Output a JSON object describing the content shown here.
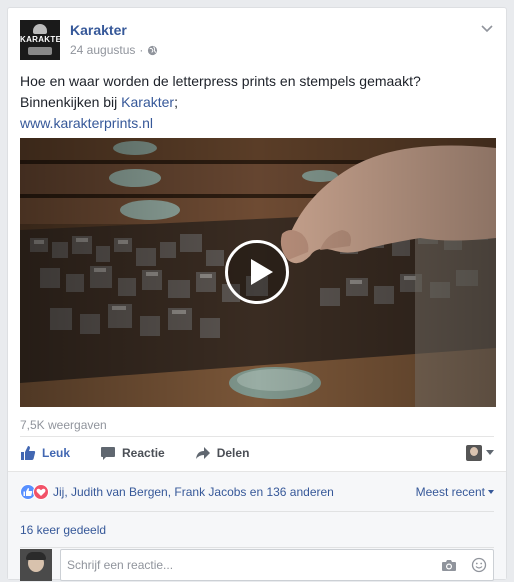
{
  "post": {
    "page_name": "Karakter",
    "avatar_text": "KARAKTER",
    "date": "24 augustus",
    "separator": "·",
    "text_line1": "Hoe en waar worden de letterpress prints en stempels gemaakt?",
    "text_line2_prefix": "Binnenkijken bij ",
    "text_line2_link": "Karakter",
    "text_line2_suffix": ";",
    "url": "www.karakterprints.nl"
  },
  "video": {
    "views": "7,5K weergaven"
  },
  "actions": {
    "like": "Leuk",
    "comment": "Reactie",
    "share": "Delen"
  },
  "reactions": {
    "names": "Jij, Judith van Bergen, Frank Jacobs en 136 anderen",
    "sort": "Meest recent"
  },
  "shares": {
    "text": "16 keer gedeeld"
  },
  "composer": {
    "placeholder": "Schrijf een reactie..."
  },
  "colors": {
    "link": "#365899",
    "like_blue": "#4267b2",
    "love_red": "#f25268"
  }
}
